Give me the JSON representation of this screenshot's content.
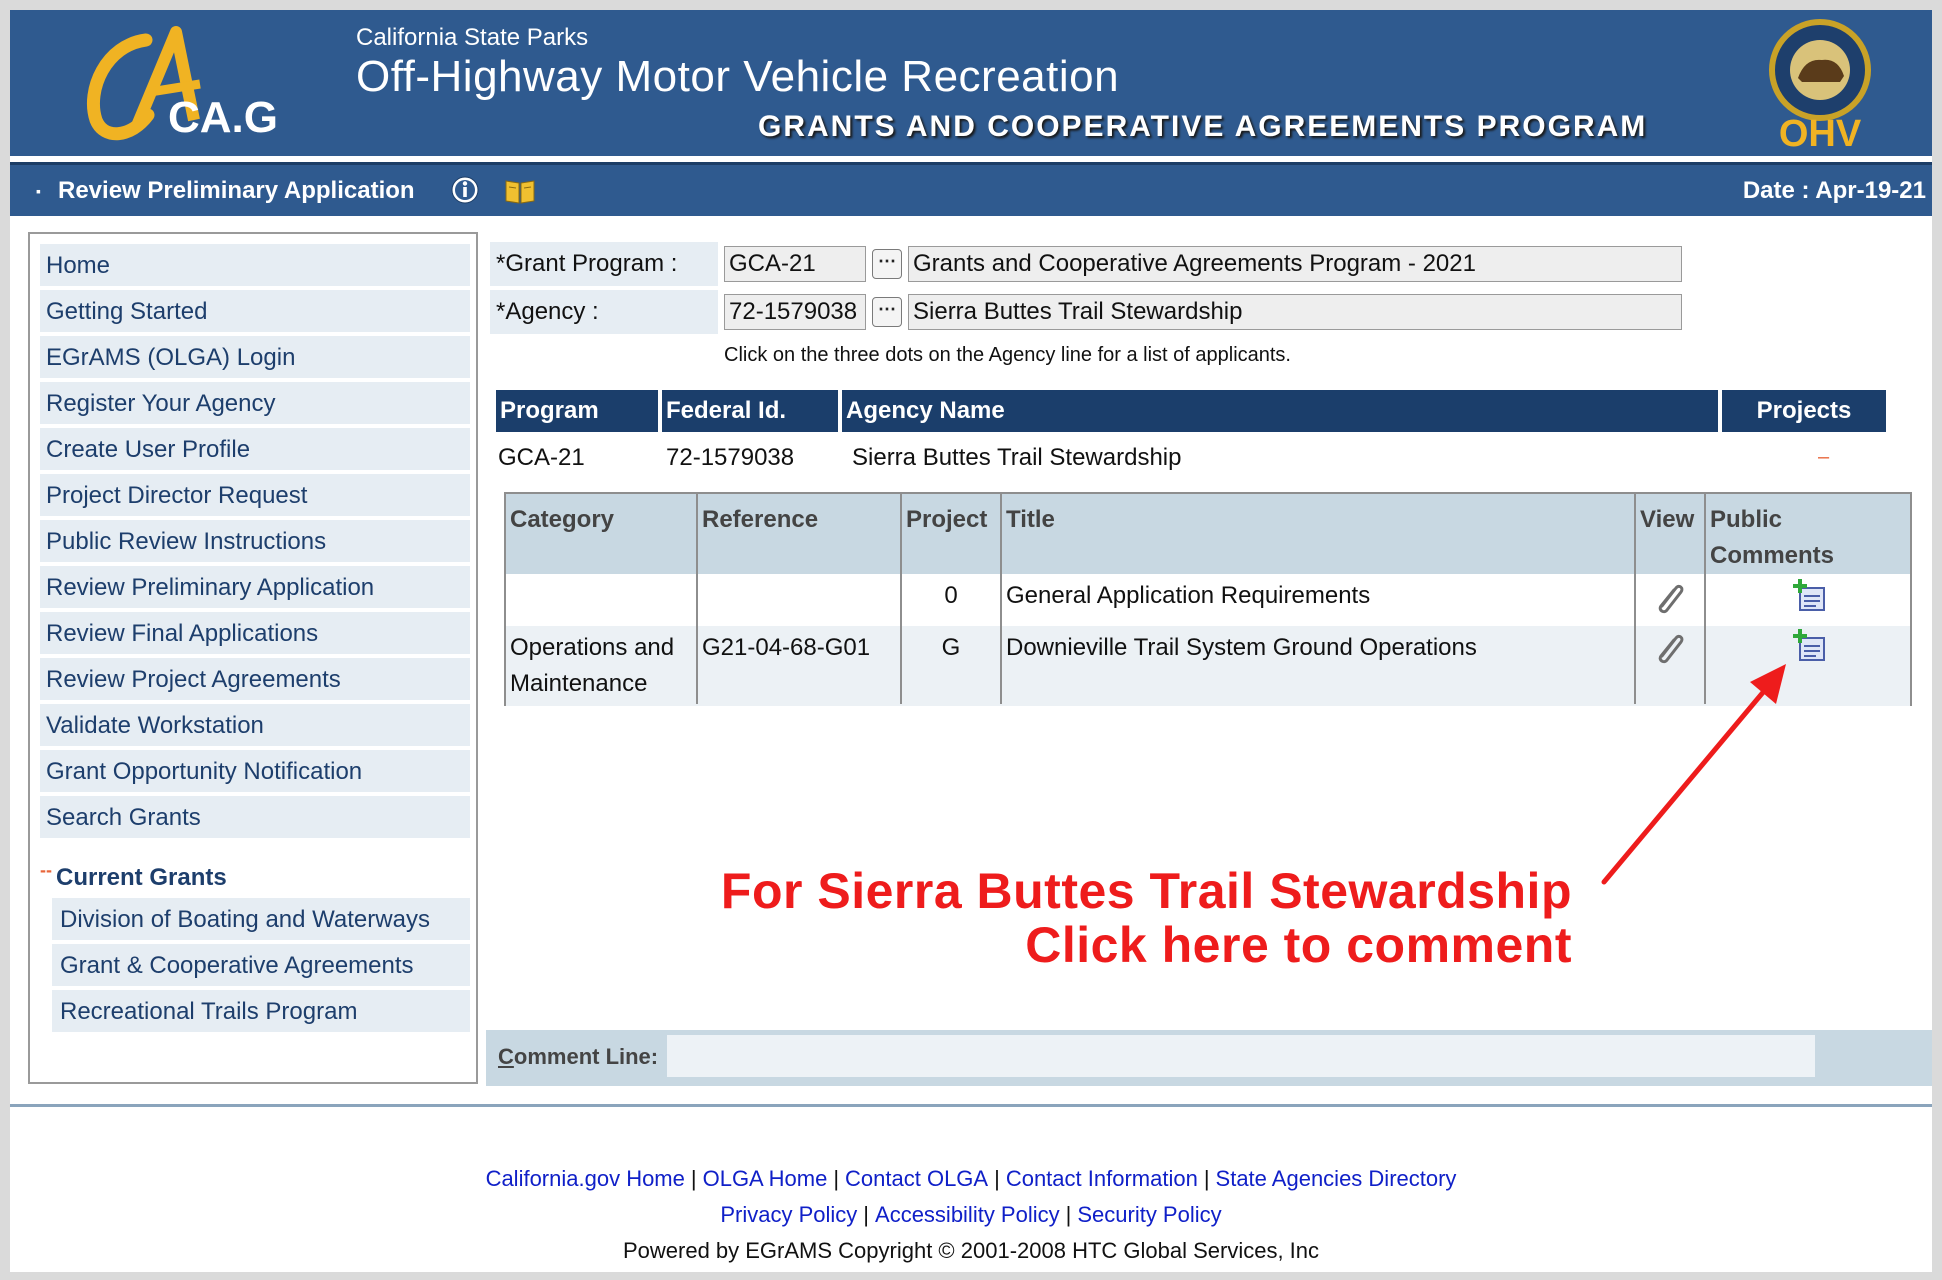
{
  "header": {
    "logo_text": "CA.GOV",
    "state_parks": "California State Parks",
    "program_title": "Off-Highway Motor Vehicle Recreation",
    "grants_title": "GRANTS AND COOPERATIVE AGREEMENTS PROGRAM",
    "ohv_logo_text": "OHV"
  },
  "titlebar": {
    "heading": "Review Preliminary Application",
    "date": "Date : Apr-19-21"
  },
  "sidebar": {
    "items": [
      "Home",
      "Getting Started",
      "EGrAMS (OLGA) Login",
      "Register Your Agency",
      "Create User Profile",
      "Project Director Request",
      "Public Review Instructions",
      "Review Preliminary Application",
      "Review Final Applications",
      "Review Project Agreements",
      "Validate Workstation",
      "Grant Opportunity Notification",
      "Search Grants"
    ],
    "current_grants_mark": "--",
    "current_grants": "Current Grants",
    "sub_items": [
      "Division of Boating and Waterways",
      "Grant & Cooperative Agreements",
      "Recreational Trails Program"
    ]
  },
  "form": {
    "grant_program_label": "*Grant Program :",
    "grant_program_code": "GCA-21",
    "grant_program_name": "Grants and Cooperative Agreements Program - 2021",
    "agency_label": "*Agency :",
    "agency_code": "72-1579038",
    "agency_name": "Sierra Buttes Trail Stewardship",
    "dots": "⋯",
    "hint": "Click on the three dots on the Agency line for a list of applicants."
  },
  "agency_table": {
    "headers": [
      "Program",
      "Federal Id.",
      "Agency Name",
      "Projects"
    ],
    "row": {
      "program": "GCA-21",
      "federal_id": "72-1579038",
      "agency_name": "Sierra Buttes Trail Stewardship",
      "projects_toggle": "–"
    }
  },
  "project_table": {
    "headers": {
      "category": "Category",
      "reference": "Reference",
      "project": "Project",
      "title": "Title",
      "view": "View",
      "public_comments_1": "Public",
      "public_comments_2": "Comments"
    },
    "rows": [
      {
        "category_1": "",
        "category_2": "",
        "reference": "",
        "project": "0",
        "title": "General Application Requirements"
      },
      {
        "category_1": "Operations and",
        "category_2": "Maintenance",
        "reference": "G21-04-68-G01",
        "project": "G",
        "title": "Downieville Trail System Ground Operations"
      }
    ]
  },
  "annotation": {
    "line1": "For Sierra Buttes Trail Stewardship",
    "line2": "Click here to comment",
    "color": "#ee1c1c"
  },
  "comment_line": {
    "label_first": "C",
    "label_rest": "omment Line:",
    "value": ""
  },
  "footer": {
    "links_row1": [
      "California.gov Home",
      "OLGA Home",
      "Contact OLGA",
      "Contact Information",
      "State Agencies Directory"
    ],
    "links_row2": [
      "Privacy Policy",
      "Accessibility Policy",
      "Security Policy"
    ],
    "separator": "|",
    "powered_by": "Powered by EGrAMS Copyright © 2001-2008 HTC Global Services, Inc"
  },
  "colors": {
    "header_bg": "#2f5a8f",
    "table_header": "#1b3e6b",
    "nav_bg": "#e6edf3",
    "link": "#1020c8"
  }
}
